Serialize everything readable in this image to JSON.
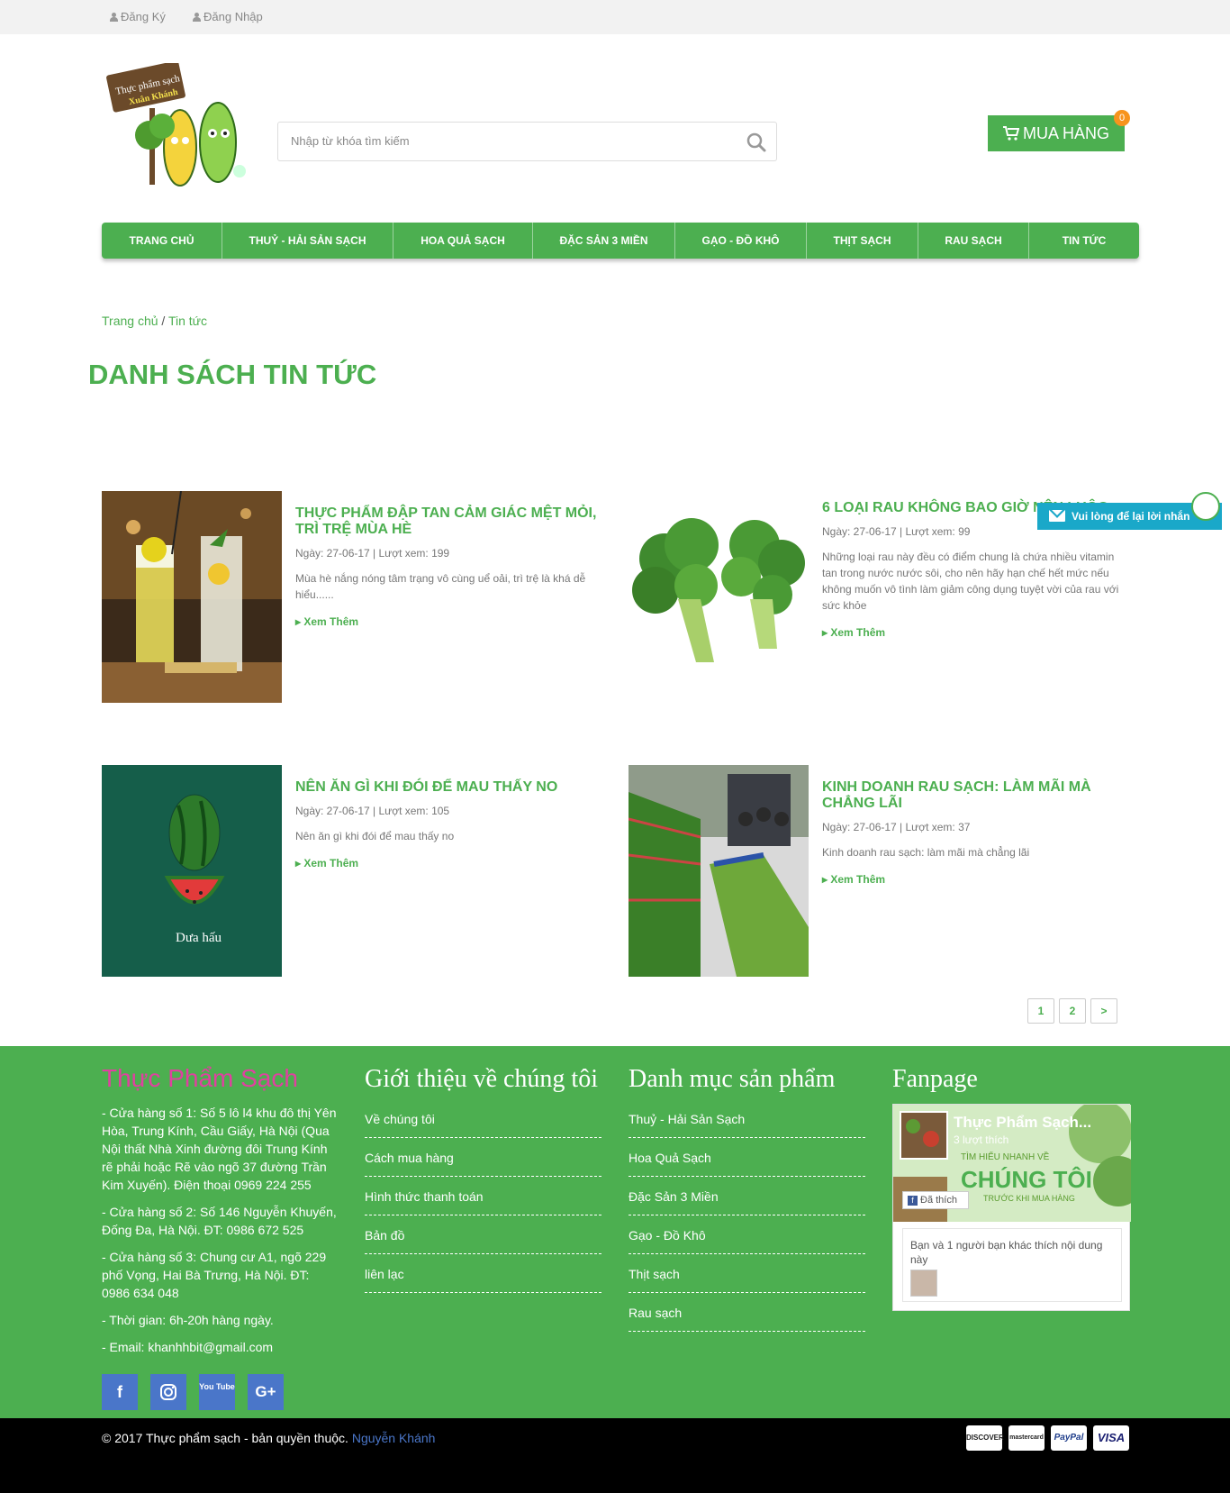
{
  "topbar": {
    "register": "Đăng Ký",
    "login": "Đăng Nhập"
  },
  "search": {
    "placeholder": "Nhập từ khóa tìm kiếm"
  },
  "cart": {
    "label": "MUA HÀNG",
    "count": "0"
  },
  "logo": {
    "line1": "Thực phẩm sạch",
    "line2": "Xuân Khánh"
  },
  "nav": [
    "TRANG CHỦ",
    "THUỶ - HẢI SẢN SẠCH",
    "HOA QUẢ SẠCH",
    "ĐẶC SẢN 3 MIỀN",
    "GẠO - ĐỒ KHÔ",
    "THỊT SẠCH",
    "RAU SẠCH",
    "TIN TỨC"
  ],
  "breadcrumb": {
    "home": "Trang chủ",
    "separator": "/",
    "current": "Tin tức"
  },
  "page_title": "DANH SÁCH TIN TỨC",
  "posts": [
    {
      "title": "THỰC PHẨM ĐẬP TAN CẢM GIÁC MỆT MỎI, TRÌ TRỆ MÙA HÈ",
      "meta": "Ngày: 27-06-17 | Lượt xem: 199",
      "desc": "Mùa hè nắng nóng tâm trạng vô cùng uể oải, trì trệ là khá dễ hiểu......",
      "more": "Xem Thêm"
    },
    {
      "title": "6 LOẠI RAU KHÔNG BAO GIỜ NÊN LUỘC",
      "meta": "Ngày: 27-06-17 | Lượt xem: 99",
      "desc": "Những loại rau này đều có điểm chung là chứa nhiều vitamin tan trong nước nước sôi, cho nên hãy hạn chế hết mức nếu không muốn vô tình làm giảm công dụng tuyệt vời của rau với sức khỏe",
      "more": "Xem Thêm"
    },
    {
      "title": "NÊN ĂN GÌ KHI ĐÓI ĐỂ MAU THẤY NO",
      "meta": "Ngày: 27-06-17 | Lượt xem: 105",
      "desc": "Nên ăn gì khi đói để mau thấy no",
      "more": "Xem Thêm",
      "thumb_caption": "Dưa hấu"
    },
    {
      "title": "KINH DOANH RAU SẠCH: LÀM MÃI MÀ CHẲNG LÃI",
      "meta": "Ngày: 27-06-17 | Lượt xem: 37",
      "desc": "Kinh doanh rau sạch: làm mãi mà chẳng lãi",
      "more": "Xem Thêm"
    }
  ],
  "pagination": [
    "1",
    "2",
    ">"
  ],
  "chat": {
    "label": "Vui lòng để lại lời nhắn"
  },
  "footer": {
    "brand": "Thực Phẩm Sạch",
    "address": [
      "- Cửa hàng số 1: Số 5 lô l4 khu đô thị Yên Hòa, Trung Kính, Cầu Giấy, Hà Nội (Qua Nội thất Nhà Xinh đường đôi Trung Kính rẽ phải hoặc Rẽ vào ngõ 37 đường Trần Kim Xuyến). Điện thoại 0969 224 255",
      "- Cửa hàng số 2: Số 146 Nguyễn Khuyến, Đống Đa, Hà Nội. ĐT: 0986 672 525",
      "- Cửa hàng số 3: Chung cư A1, ngõ 229 phố Vọng, Hai Bà Trưng, Hà Nội. ĐT: 0986 634 048",
      "- Thời gian: 6h-20h hàng ngày.",
      "- Email: khanhhbit@gmail.com"
    ],
    "about_title": "Giới thiệu về chúng tôi",
    "about_links": [
      "Về chúng tôi",
      "Cách mua hàng",
      "Hình thức thanh toán",
      "Bản đồ",
      "liên lạc"
    ],
    "cat_title": "Danh mục sản phẩm",
    "cat_links": [
      "Thuỷ - Hải Sản Sạch",
      "Hoa Quả Sạch",
      "Đặc Sản 3 Miền",
      "Gạo - Đồ Khô",
      "Thịt sạch",
      "Rau sạch"
    ],
    "fanpage_title": "Fanpage",
    "fanpage": {
      "name": "Thực Phẩm Sạch...",
      "likes": "3 lượt thích",
      "cover_line1": "TÌM HIỂU NHANH VỀ",
      "cover_line2": "CHÚNG TÔI",
      "cover_line3": "TRƯỚC KHI MUA HÀNG",
      "liked": "Đã thích",
      "friends": "Bạn và 1 người bạn khác thích nội dung này"
    },
    "social": [
      "f",
      "ig",
      "You Tube",
      "G+"
    ]
  },
  "bottom": {
    "copyright": "© 2017 Thực phẩm sạch - bản quyền thuộc.",
    "author": "Nguyễn Khánh",
    "payments": [
      "DISCOVER",
      "mastercard",
      "PayPal",
      "VISA"
    ]
  },
  "colors": {
    "green": "#4caf50",
    "topbar": "#f2f2f2",
    "chat": "#1aa8c9",
    "social": "#4a76c9",
    "badge": "#f7941d"
  }
}
